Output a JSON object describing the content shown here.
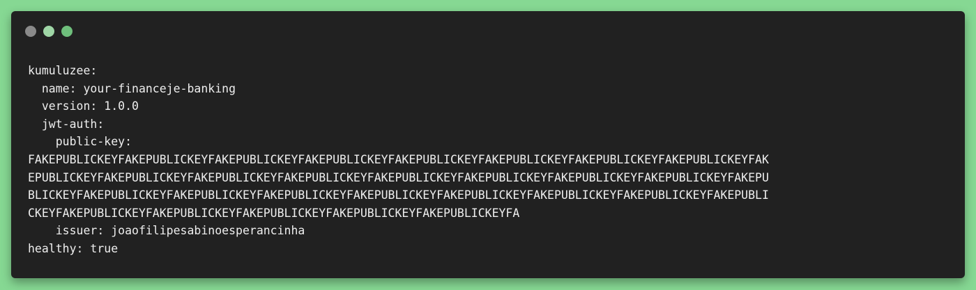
{
  "window": {
    "dots": [
      {
        "name": "window-dot-1",
        "color": "#8a8a8a"
      },
      {
        "name": "window-dot-2",
        "color": "#9fd6a6"
      },
      {
        "name": "window-dot-3",
        "color": "#6fbf7c"
      }
    ]
  },
  "code": {
    "lines": [
      "kumuluzee:",
      "  name: your-financeje-banking",
      "  version: 1.0.0",
      "  jwt-auth:",
      "    public-key:",
      "FAKEPUBLICKEYFAKEPUBLICKEYFAKEPUBLICKEYFAKEPUBLICKEYFAKEPUBLICKEYFAKEPUBLICKEYFAKEPUBLICKEYFAKEPUBLICKEYFAK",
      "EPUBLICKEYFAKEPUBLICKEYFAKEPUBLICKEYFAKEPUBLICKEYFAKEPUBLICKEYFAKEPUBLICKEYFAKEPUBLICKEYFAKEPUBLICKEYFAKEPU",
      "BLICKEYFAKEPUBLICKEYFAKEPUBLICKEYFAKEPUBLICKEYFAKEPUBLICKEYFAKEPUBLICKEYFAKEPUBLICKEYFAKEPUBLICKEYFAKEPUBLI",
      "CKEYFAKEPUBLICKEYFAKEPUBLICKEYFAKEPUBLICKEYFAKEPUBLICKEYFAKEPUBLICKEYFA",
      "    issuer: joaofilipesabinoesperancinha",
      "healthy: true"
    ]
  }
}
